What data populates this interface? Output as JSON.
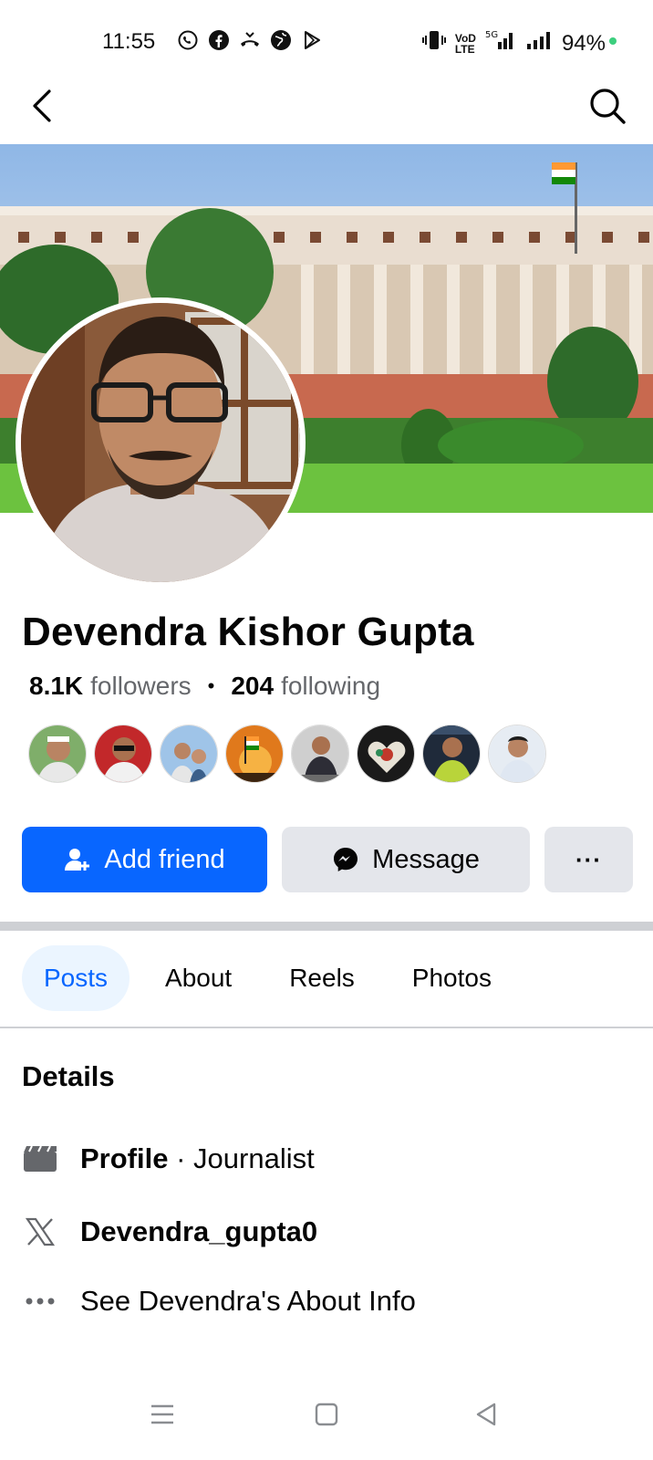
{
  "status": {
    "time": "11:55",
    "network": "5G",
    "battery": "94%"
  },
  "nav": {
    "back_icon": "back-arrow-icon",
    "search_icon": "search-icon"
  },
  "profile": {
    "name": "Devendra Kishor Gupta",
    "followers_count": "8.1K",
    "followers_label": "followers",
    "following_count": "204",
    "following_label": "following",
    "friend_thumbnails": 8
  },
  "actions": {
    "add_friend": "Add friend",
    "message": "Message",
    "more": "···"
  },
  "tabs": [
    {
      "label": "Posts",
      "active": true
    },
    {
      "label": "About",
      "active": false
    },
    {
      "label": "Reels",
      "active": false
    },
    {
      "label": "Photos",
      "active": false
    }
  ],
  "details": {
    "title": "Details",
    "profile_label": "Profile",
    "profile_sep": " · ",
    "profile_value": "Journalist",
    "twitter_handle": "Devendra_gupta0",
    "see_about": "See Devendra's About Info"
  },
  "colors": {
    "accent": "#0866ff",
    "button_gray": "#e4e6eb",
    "tab_active_bg": "#ebf5ff"
  }
}
